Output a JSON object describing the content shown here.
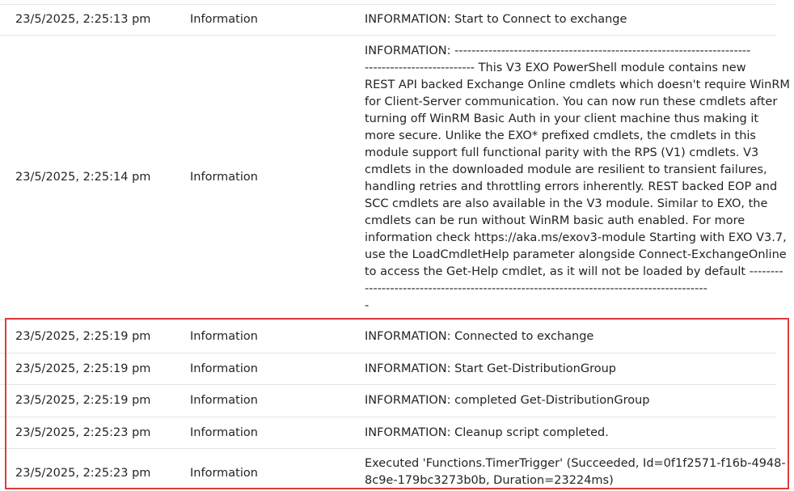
{
  "log": {
    "rows": [
      {
        "timestamp": "23/5/2025, 2:25:13 pm",
        "level": "Information",
        "message_lines": [
          "INFORMATION: Start to Connect to exchange"
        ]
      },
      {
        "timestamp": "23/5/2025, 2:25:14 pm",
        "level": "Information",
        "message_lines": [
          "INFORMATION: ----------------------------------------------------------------------",
          "-------------------------- This V3 EXO PowerShell module contains new",
          "REST API backed Exchange Online cmdlets which doesn't require WinRM",
          "for Client-Server communication. You can now run these cmdlets after",
          "turning off WinRM Basic Auth in your client machine thus making it",
          "more secure. Unlike the EXO* prefixed cmdlets, the cmdlets in this",
          "module support full functional parity with the RPS (V1) cmdlets. V3",
          "cmdlets in the downloaded module are resilient to transient failures,",
          "handling retries and throttling errors inherently. REST backed EOP and",
          "SCC cmdlets are also available in the V3 module. Similar to EXO, the",
          "cmdlets can be run without WinRM basic auth enabled. For more",
          "information check https://aka.ms/exov3-module Starting with EXO V3.7,",
          "use the LoadCmdletHelp parameter alongside Connect-ExchangeOnline",
          "to access the Get-Help cmdlet, as it will not be loaded by default --------",
          "---------------------------------------------------------------------------------",
          "-"
        ]
      },
      {
        "timestamp": "23/5/2025, 2:25:19 pm",
        "level": "Information",
        "message_lines": [
          "INFORMATION: Connected to exchange"
        ]
      },
      {
        "timestamp": "23/5/2025, 2:25:19 pm",
        "level": "Information",
        "message_lines": [
          "INFORMATION: Start Get-DistributionGroup"
        ]
      },
      {
        "timestamp": "23/5/2025, 2:25:19 pm",
        "level": "Information",
        "message_lines": [
          "INFORMATION: completed Get-DistributionGroup"
        ]
      },
      {
        "timestamp": "23/5/2025, 2:25:23 pm",
        "level": "Information",
        "message_lines": [
          "INFORMATION: Cleanup script completed."
        ]
      },
      {
        "timestamp": "23/5/2025, 2:25:23 pm",
        "level": "Information",
        "message_lines": [
          "Executed 'Functions.TimerTrigger' (Succeeded, Id=0f1f2571-f16b-4948-",
          "8c9e-179bc3273b0b, Duration=23224ms)"
        ]
      }
    ]
  },
  "colors": {
    "highlight_border": "#e03c3c",
    "row_divider": "#e5e5e5",
    "text": "#242424"
  }
}
